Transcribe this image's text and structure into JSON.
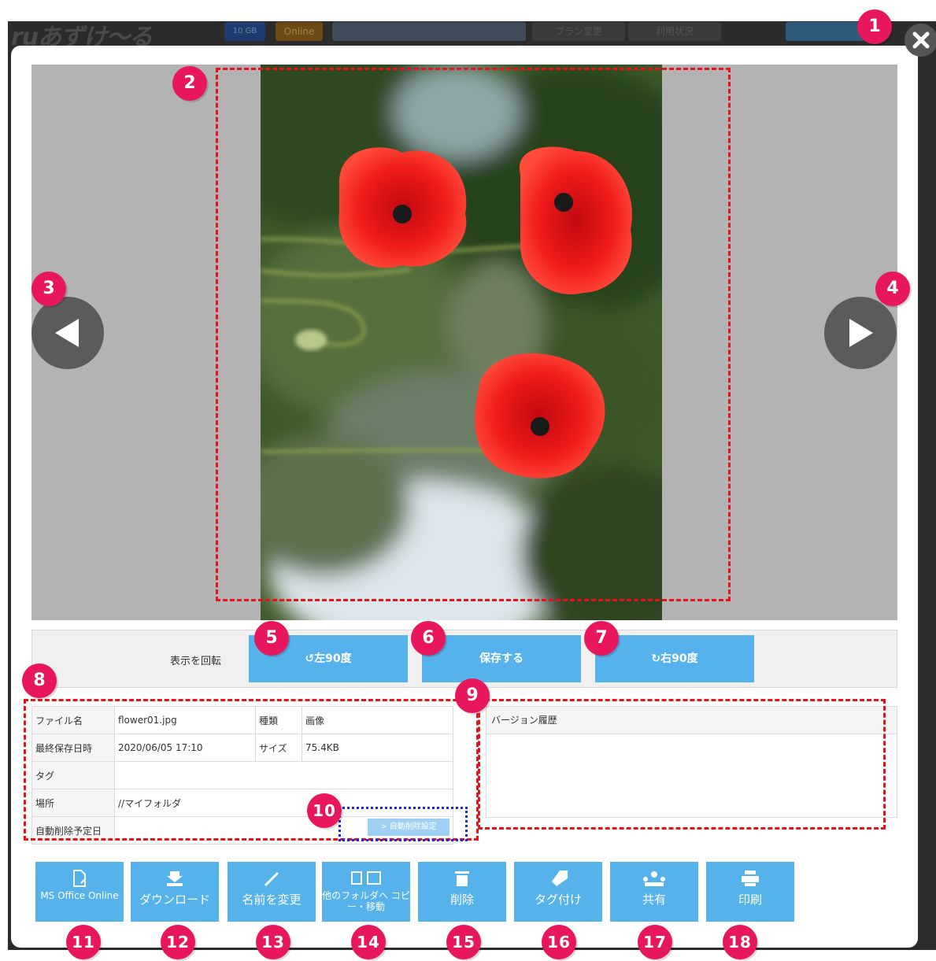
{
  "background": {
    "logo_text": "ruあずけ〜る",
    "storage_badge": "10 GB",
    "online_badge": "Online",
    "plan_change": "プラン変更",
    "usage": "利用状況"
  },
  "viewer": {
    "image_alt": "red poppy flowers"
  },
  "rotate_bar": {
    "label": "表示を回転",
    "left_label": "左90度",
    "save_label": "保存する",
    "right_label": "右90度"
  },
  "file_info": {
    "name_label": "ファイル名",
    "name_value": "flower01.jpg",
    "type_label": "種類",
    "type_value": "画像",
    "saved_label": "最終保存日時",
    "saved_value": "2020/06/05 17:10",
    "size_label": "サイズ",
    "size_value": "75.4KB",
    "tag_label": "タグ",
    "location_label": "場所",
    "location_value": "//マイフォルダ",
    "autodelete_label": "自動削除予定日",
    "autodelete_button": "> 自動削除設定"
  },
  "version": {
    "header": "バージョン履歴"
  },
  "actions": [
    {
      "label": "MS Office Online"
    },
    {
      "label": "ダウンロード"
    },
    {
      "label": "名前を変更"
    },
    {
      "label": "他のフォルダへ コピー・移動"
    },
    {
      "label": "削除"
    },
    {
      "label": "タグ付け"
    },
    {
      "label": "共有"
    },
    {
      "label": "印刷"
    }
  ],
  "callouts": [
    "1",
    "2",
    "3",
    "4",
    "5",
    "6",
    "7",
    "8",
    "9",
    "10",
    "11",
    "12",
    "13",
    "14",
    "15",
    "16",
    "17",
    "18"
  ],
  "colors": {
    "accent": "#56b2ea",
    "callout": "#e8175d",
    "highlight_red": "#e8131a",
    "highlight_blue": "#1a28e8"
  }
}
